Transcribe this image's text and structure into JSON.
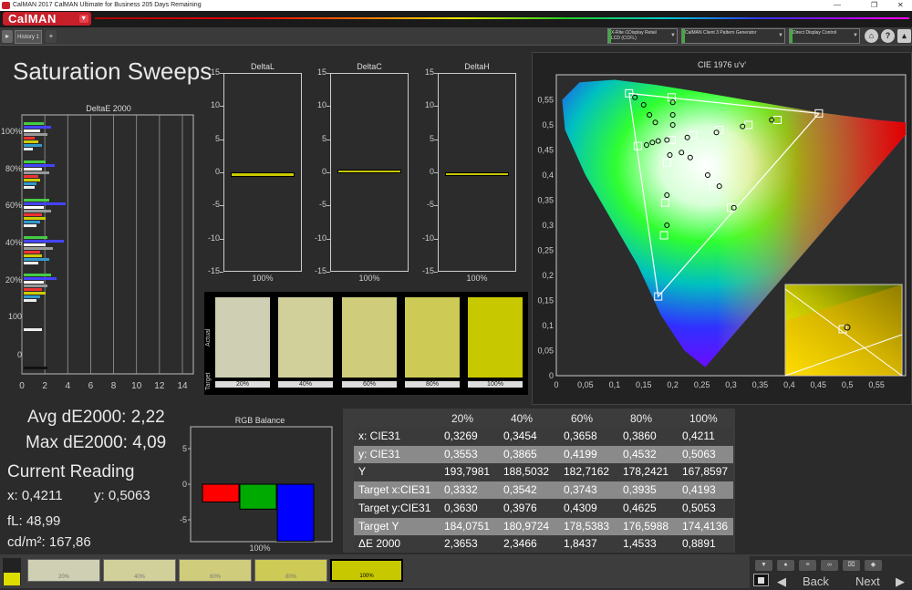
{
  "window": {
    "title": "CalMAN 2017 CalMAN Ultimate for Business 205 Days Remaining",
    "minimize": "—",
    "maximize": "❐",
    "close": "✕"
  },
  "app": {
    "logo": "CalMAN"
  },
  "tabs": {
    "history": "History 1"
  },
  "devices": {
    "meter": "X-Rite i1Display Retail LCD (CCFL)",
    "pattern": "CalMAN Client 3 Pattern Generator",
    "display": "Direct Display Control"
  },
  "page": {
    "title": "Saturation Sweeps"
  },
  "de2000": {
    "title": "DeltaE 2000",
    "y_labels": [
      "100%",
      "80%",
      "60%",
      "40%",
      "20%",
      "100",
      "0"
    ],
    "x_ticks": [
      "0",
      "2",
      "4",
      "6",
      "8",
      "10",
      "12",
      "14"
    ]
  },
  "delta_charts": [
    {
      "title": "DeltaL",
      "value": -0.5,
      "xlabel": "100%"
    },
    {
      "title": "DeltaC",
      "value": 0.4,
      "xlabel": "100%"
    },
    {
      "title": "DeltaH",
      "value": -0.2,
      "xlabel": "100%"
    }
  ],
  "delta_y_ticks": [
    "15",
    "10",
    "5",
    "0",
    "-5",
    "-10",
    "-15"
  ],
  "swatches": {
    "actual_label": "Actual",
    "target_label": "Target",
    "items": [
      {
        "label": "20%",
        "color": "#cfcfb3"
      },
      {
        "label": "40%",
        "color": "#d1d09a"
      },
      {
        "label": "60%",
        "color": "#cfcc7c"
      },
      {
        "label": "80%",
        "color": "#cdca55"
      },
      {
        "label": "100%",
        "color": "#c8c800"
      }
    ]
  },
  "stats": {
    "avg": "Avg dE2000: 2,22",
    "max": "Max dE2000: 4,09",
    "current_heading": "Current Reading",
    "x": "x: 0,4211",
    "y": "y: 0,5063",
    "fl": "fL: 48,99",
    "cd": "cd/m²: 167,86"
  },
  "rgb_balance": {
    "title": "RGB Balance",
    "y_ticks": [
      "5",
      "0",
      "-5"
    ],
    "xlabel": "100%",
    "values": {
      "red": -2.5,
      "green": -3.5,
      "blue": -8
    }
  },
  "cie": {
    "title": "CIE 1976 u'v'",
    "x_ticks": [
      "0",
      "0,05",
      "0,1",
      "0,15",
      "0,2",
      "0,25",
      "0,3",
      "0,35",
      "0,4",
      "0,45",
      "0,5",
      "0,55"
    ],
    "y_ticks": [
      "0,55",
      "0,5",
      "0,45",
      "0,4",
      "0,35",
      "0,3",
      "0,25",
      "0,2",
      "0,15",
      "0,1",
      "0,05",
      "0"
    ]
  },
  "table": {
    "headers": [
      "",
      "20%",
      "40%",
      "60%",
      "80%",
      "100%"
    ],
    "rows": [
      [
        "x: CIE31",
        "0,3269",
        "0,3454",
        "0,3658",
        "0,3860",
        "0,4211"
      ],
      [
        "y: CIE31",
        "0,3553",
        "0,3865",
        "0,4199",
        "0,4532",
        "0,5063"
      ],
      [
        "Y",
        "193,7981",
        "188,5032",
        "182,7162",
        "178,2421",
        "167,8597"
      ],
      [
        "Target x:CIE31",
        "0,3332",
        "0,3542",
        "0,3743",
        "0,3935",
        "0,4193"
      ],
      [
        "Target y:CIE31",
        "0,3630",
        "0,3976",
        "0,4309",
        "0,4625",
        "0,5053"
      ],
      [
        "Target Y",
        "184,0751",
        "180,9724",
        "178,5383",
        "176,5988",
        "174,4136"
      ],
      [
        "ΔE 2000",
        "2,3653",
        "2,3466",
        "1,8437",
        "1,4533",
        "0,8891"
      ]
    ]
  },
  "bottom": {
    "swatches": [
      {
        "label": "20%",
        "color": "#cfcfb3"
      },
      {
        "label": "40%",
        "color": "#d1d09a"
      },
      {
        "label": "60%",
        "color": "#cfcc7c"
      },
      {
        "label": "80%",
        "color": "#cdca55"
      },
      {
        "label": "100%",
        "color": "#c8c800"
      }
    ],
    "back": "Back",
    "next": "Next"
  }
}
